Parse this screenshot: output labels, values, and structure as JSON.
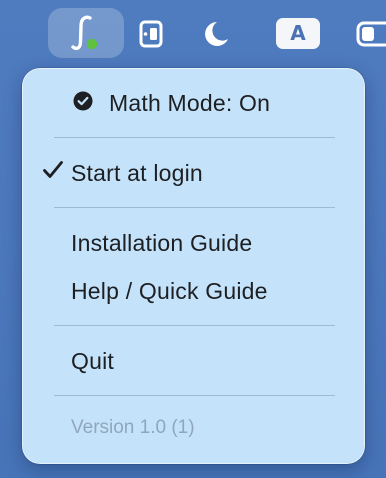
{
  "menubar": {
    "icons": [
      {
        "name": "math-app-icon",
        "status_color": "#5fc23c"
      },
      {
        "name": "mirror-icon"
      },
      {
        "name": "moon-icon"
      },
      {
        "name": "keyboard-input-icon",
        "text": "A"
      },
      {
        "name": "toggle-icon"
      }
    ]
  },
  "menu": {
    "math_mode_label": "Math Mode: On",
    "start_at_login_label": "Start at login",
    "start_at_login_checked": true,
    "installation_guide_label": "Installation Guide",
    "help_label": "Help / Quick Guide",
    "quit_label": "Quit",
    "version_label": "Version 1.0 (1)"
  },
  "colors": {
    "menu_background": "#c4e2f9",
    "desktop_background": "#4c78bd",
    "text": "#1d1f22",
    "disabled_text": "#8fa7bd"
  }
}
